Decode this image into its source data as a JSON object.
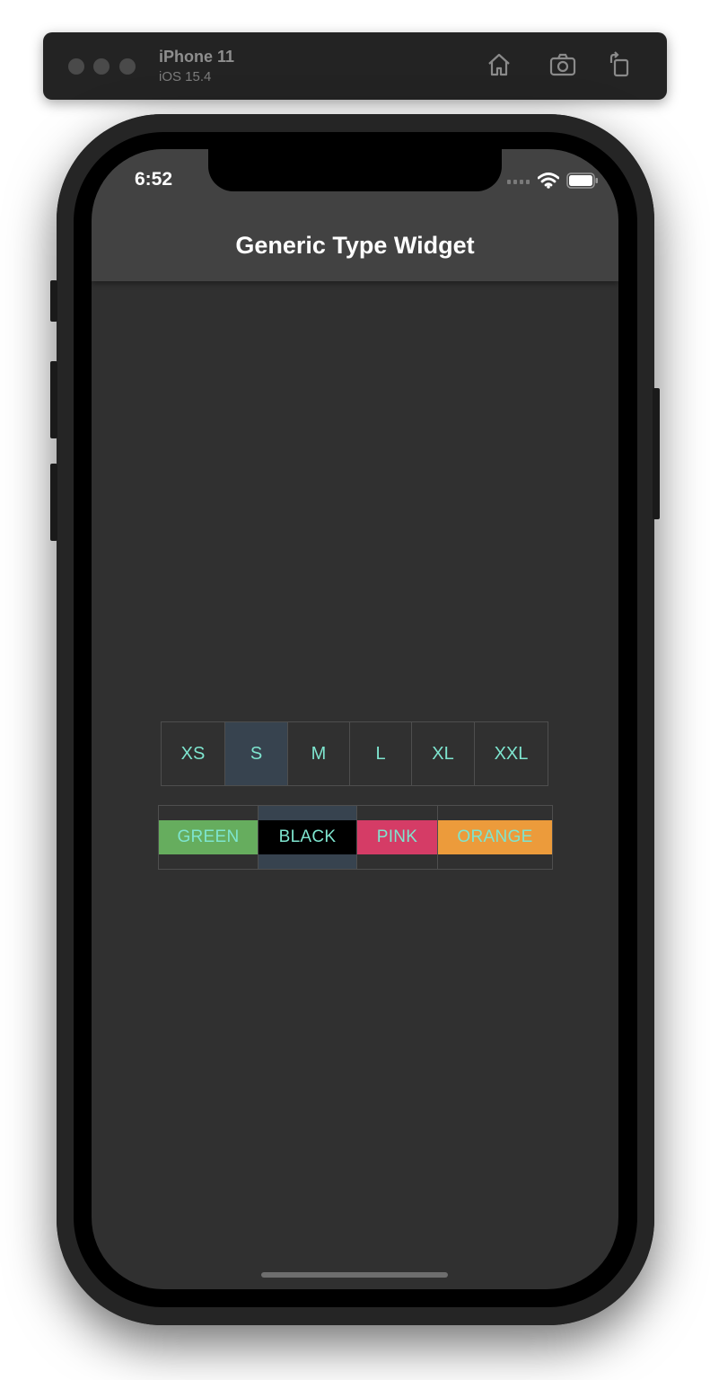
{
  "simulator": {
    "device_name": "iPhone 11",
    "os_version": "iOS 15.4"
  },
  "status_bar": {
    "time": "6:52"
  },
  "app_bar": {
    "title": "Generic Type Widget"
  },
  "sizes": [
    {
      "label": "XS",
      "selected": false
    },
    {
      "label": "S",
      "selected": true
    },
    {
      "label": "M",
      "selected": false
    },
    {
      "label": "L",
      "selected": false
    },
    {
      "label": "XL",
      "selected": false
    },
    {
      "label": "XXL",
      "selected": false
    }
  ],
  "colors": [
    {
      "label": "GREEN",
      "color": "#66ad5e",
      "selected": false
    },
    {
      "label": "BLACK",
      "color": "#000000",
      "selected": true
    },
    {
      "label": "PINK",
      "color": "#d53c66",
      "selected": false
    },
    {
      "label": "ORANGE",
      "color": "#ec9b3b",
      "selected": false
    }
  ],
  "theme": {
    "background": "#303030",
    "app_bar": "#424242",
    "label_color": "#7ee5cf",
    "selected_cell": "#37434f"
  }
}
